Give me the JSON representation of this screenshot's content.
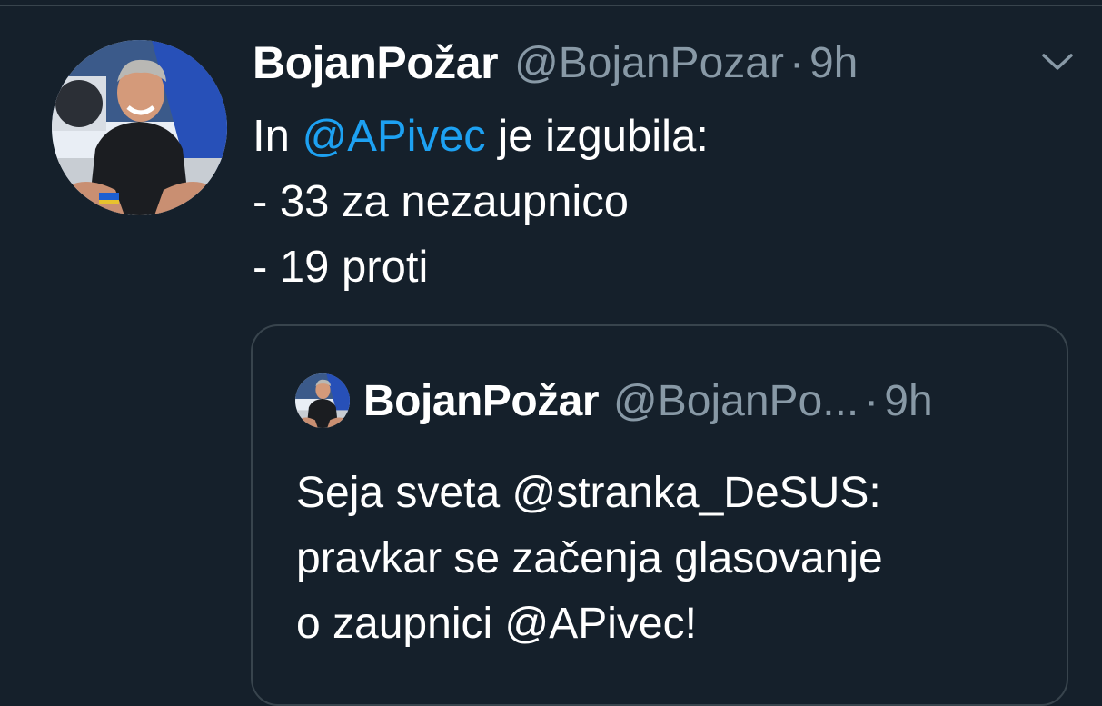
{
  "tweet": {
    "author_name": "BojanPožar",
    "handle": "@BojanPozar",
    "separator": "·",
    "time": "9h",
    "text_intro": "In ",
    "mention": "@APivec",
    "text_after_mention": " je izgubila:",
    "line_2": "- 33 za nezaupnico",
    "line_3": "- 19 proti",
    "menu_icon": "chevron-down-icon"
  },
  "quoted_tweet": {
    "author_name": "BojanPožar",
    "handle": "@BojanPo...",
    "separator": "·",
    "time": "9h",
    "line_1": "Seja sveta @stranka_DeSUS:",
    "line_2": "pravkar se začenja glasovanje",
    "line_3": "o zaupnici @APivec!"
  },
  "colors": {
    "background": "#15202b",
    "accent": "#1da1f2",
    "secondary_text": "#8899a6",
    "border": "#38444d"
  }
}
